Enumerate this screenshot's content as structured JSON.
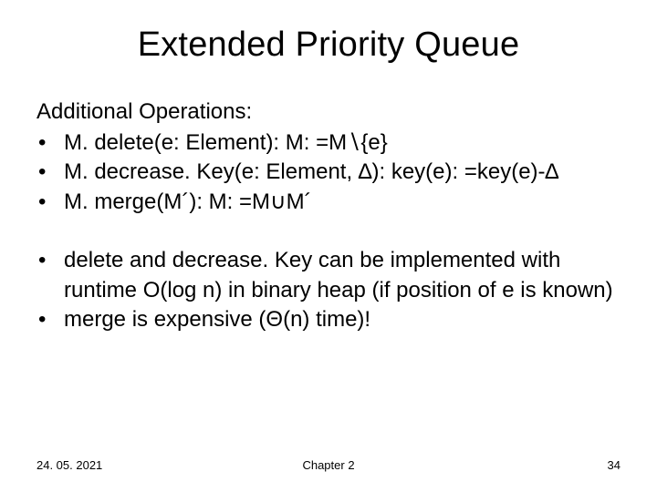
{
  "title": "Extended Priority Queue",
  "section1_heading": "Additional Operations:",
  "bullets1": {
    "0": "M. delete(e: Element): M: =M∖{e}",
    "1": "M. decrease. Key(e: Element, ∆): key(e): =key(e)-∆",
    "2": "M. merge(M´): M: =M∪M´"
  },
  "bullets2": {
    "0": "delete and decrease. Key can be implemented with runtime O(log n) in binary heap (if position of e is known)",
    "1": "merge is expensive (Θ(n) time)!"
  },
  "footer": {
    "date": "24. 05. 2021",
    "chapter": "Chapter 2",
    "page": "34"
  }
}
